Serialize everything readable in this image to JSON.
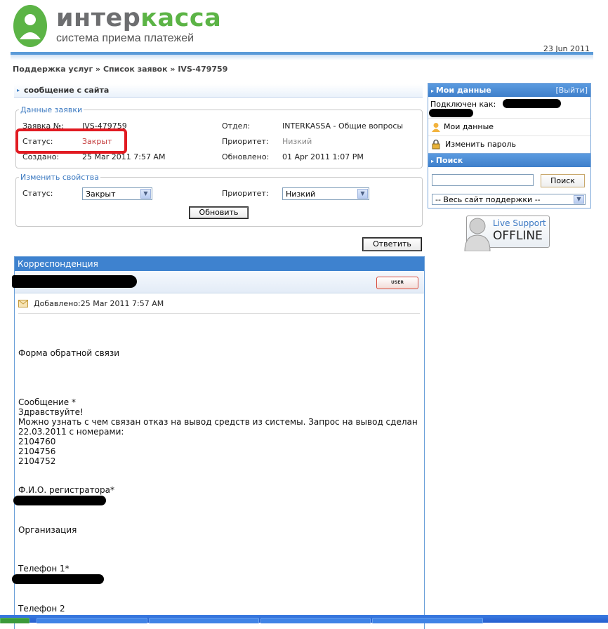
{
  "header": {
    "brand_prefix": "интер",
    "brand_suffix": "касса",
    "tagline": "система приема платежей",
    "date": "23 Jun 2011"
  },
  "breadcrumb": "Поддержка услуг » Список заявок » IVS-479759",
  "section": {
    "title": "сообщение с сайта"
  },
  "ticket_info": {
    "legend": "Данные заявки",
    "ticket_label": "Заявка №:",
    "ticket_value": "IVS-479759",
    "status_label": "Статус:",
    "status_value": "Закрыт",
    "created_label": "Создано:",
    "created_value": "25 Mar 2011 7:57 AM",
    "dept_label": "Отдел:",
    "dept_value": "INTERKASSA - Общие вопросы",
    "priority_label": "Приоритет:",
    "priority_value": "Низкий",
    "updated_label": "Обновлено:",
    "updated_value": "01 Apr 2011 1:07 PM"
  },
  "change_props": {
    "legend": "Изменить свойства",
    "status_label": "Статус:",
    "status_selected": "Закрыт",
    "priority_label": "Приоритет:",
    "priority_selected": "Низкий",
    "update_button": "Обновить"
  },
  "reply_button": "Ответить",
  "correspondence": {
    "title": "Корреспонденция",
    "badge": "USER",
    "added": "Добавлено:25 Mar 2011 7:57 AM",
    "lines": {
      "form_title": "Форма обратной связи",
      "message_label": "Сообщение *",
      "greeting": "Здравствуйте!",
      "body1": "Можно узнать с чем связан отказ на вывод средств из системы. Запрос на вывод сделан",
      "body2": "22.03.2011 с номерами:",
      "num1": "2104760",
      "num2": "2104756",
      "num3": "2104752",
      "fio_label": "Ф.И.О. регистратора*",
      "org_label": "Организация",
      "phone1_label": "Телефон 1*",
      "phone2_label": "Телефон 2"
    }
  },
  "sidebar": {
    "my_data_title": "Мои данные",
    "logout": "[Выйти]",
    "connected_as": "Подключен как:",
    "my_data_link": "Мои данные",
    "change_password": "Изменить пароль",
    "search_title": "Поиск",
    "search_button": "Поиск",
    "search_scope": "-- Весь сайт поддержки --"
  },
  "live_support": {
    "line1": "Live Support",
    "line2": "OFFLINE"
  }
}
